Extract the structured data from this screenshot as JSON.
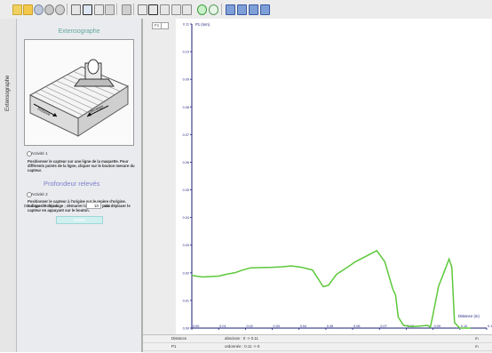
{
  "panel": {
    "title": "Extensographe",
    "vtab_label": "Extensographe",
    "device": {
      "label_left": "Distance",
      "label_right": "décalage"
    },
    "activity1": {
      "label": "Activité 1",
      "text": "Positionner le capteur sur une ligne de la maquette. Pour différents points de la ligne, cliquer sur le bouton mesure du capteur."
    },
    "subtitle": "Profondeur relevés",
    "activity2": {
      "label": "Activité 2",
      "text": "Positionner le capteur à l'origine sur le repère d'origine. Indiquer le décalage ; démarrer la mesure puis déplacer le capteur en appuyant sur le bouton."
    },
    "decalage_label": "Décalage à l'origine :",
    "decalage_value": "10",
    "decalage_unit": "mm",
    "validate_button": "Valider"
  },
  "graph": {
    "tab_label": "F1",
    "series_label": "P1 (mm)",
    "x_axis_label": "Distance (m)",
    "accent_color": "#5cc83a",
    "axis_color": "#1b1b7a"
  },
  "chart_data": {
    "type": "line",
    "title": "",
    "xlabel": "Distance (m)",
    "ylabel": "P1 (mm)",
    "xlim": [
      0,
      0.11
    ],
    "ylim": [
      0,
      0.11
    ],
    "x_ticks": [
      "0.00",
      "0.01",
      "0.02",
      "0.03",
      "0.04",
      "0.05",
      "0.06",
      "0.07",
      "0.08",
      "0.09",
      "0.10",
      "0.11"
    ],
    "y_ticks": [
      "0.00",
      "0.01",
      "0.02",
      "0.03",
      "0.04",
      "0.05",
      "0.06",
      "0.07",
      "0.08",
      "0.09",
      "0.10",
      "0.11"
    ],
    "grid": false,
    "series": [
      {
        "name": "P1 (mm)",
        "x": [
          0.0,
          0.004,
          0.01,
          0.013,
          0.016,
          0.019,
          0.022,
          0.03,
          0.034,
          0.037,
          0.041,
          0.045,
          0.047,
          0.049,
          0.051,
          0.054,
          0.058,
          0.061,
          0.065,
          0.067,
          0.069,
          0.072,
          0.075,
          0.076,
          0.077,
          0.079,
          0.082,
          0.085,
          0.088,
          0.089,
          0.09,
          0.092,
          0.094,
          0.096,
          0.097,
          0.098,
          0.1,
          0.104
        ],
        "y": [
          0.019,
          0.0185,
          0.0188,
          0.0195,
          0.02,
          0.021,
          0.0218,
          0.022,
          0.0222,
          0.0225,
          0.022,
          0.021,
          0.018,
          0.015,
          0.0155,
          0.0195,
          0.022,
          0.024,
          0.026,
          0.027,
          0.028,
          0.024,
          0.014,
          0.012,
          0.004,
          0.001,
          0.0005,
          0.0007,
          0.001,
          0.0003,
          0.005,
          0.015,
          0.02,
          0.025,
          0.022,
          0.002,
          0.0,
          0.0
        ]
      }
    ]
  },
  "status": {
    "row1_label": "Distance",
    "row1_text": "abscisse : 0 -> 0.11",
    "row1_unit": "m",
    "row2_label": "P1",
    "row2_text": "ordonnée : 0.11 -> 0",
    "row2_unit": "m"
  }
}
